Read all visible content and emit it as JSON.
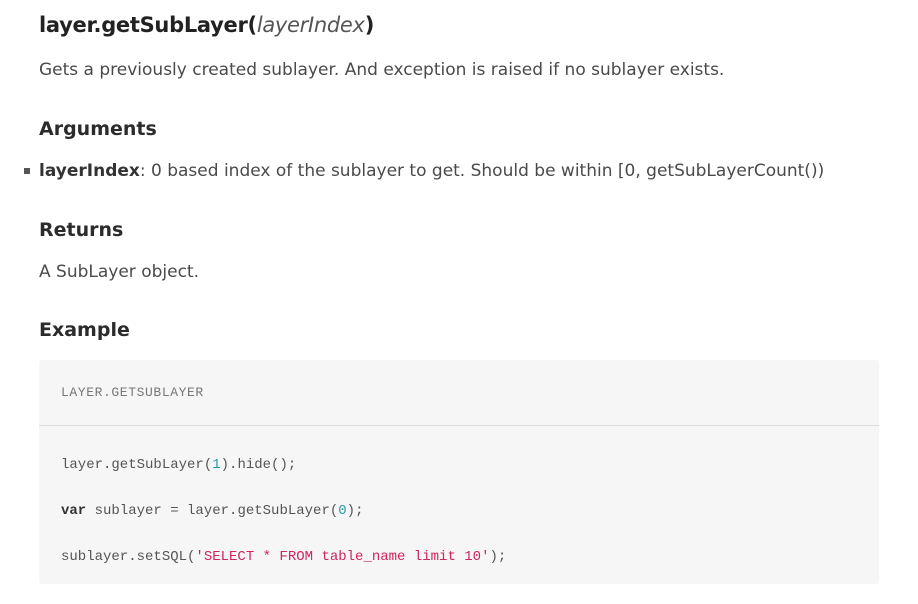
{
  "method": {
    "name": "layer.getSubLayer(",
    "param": "layerIndex",
    "close": ")"
  },
  "description": "Gets a previously created sublayer. And exception is raised if no sublayer exists.",
  "arguments": {
    "heading": "Arguments",
    "items": [
      {
        "name": "layerIndex",
        "text": ": 0 based index of the sublayer to get. Should be within [0, getSubLayerCount())"
      }
    ]
  },
  "returns": {
    "heading": "Returns",
    "text": "A SubLayer object."
  },
  "example": {
    "heading": "Example",
    "label": "LAYER.GETSUBLAYER",
    "lines": [
      {
        "parts": [
          "layer.getSubLayer(",
          "1",
          ").hide();"
        ]
      },
      {
        "parts": [
          "var",
          " sublayer = layer.getSubLayer(",
          "0",
          ");"
        ]
      },
      {
        "parts": [
          "sublayer.setSQL(",
          "'SELECT * FROM table_name limit 10'",
          ");"
        ]
      }
    ]
  },
  "colors": {
    "number": "#2a9aa8",
    "string": "#d0245c",
    "code_bg": "#f6f6f6"
  }
}
